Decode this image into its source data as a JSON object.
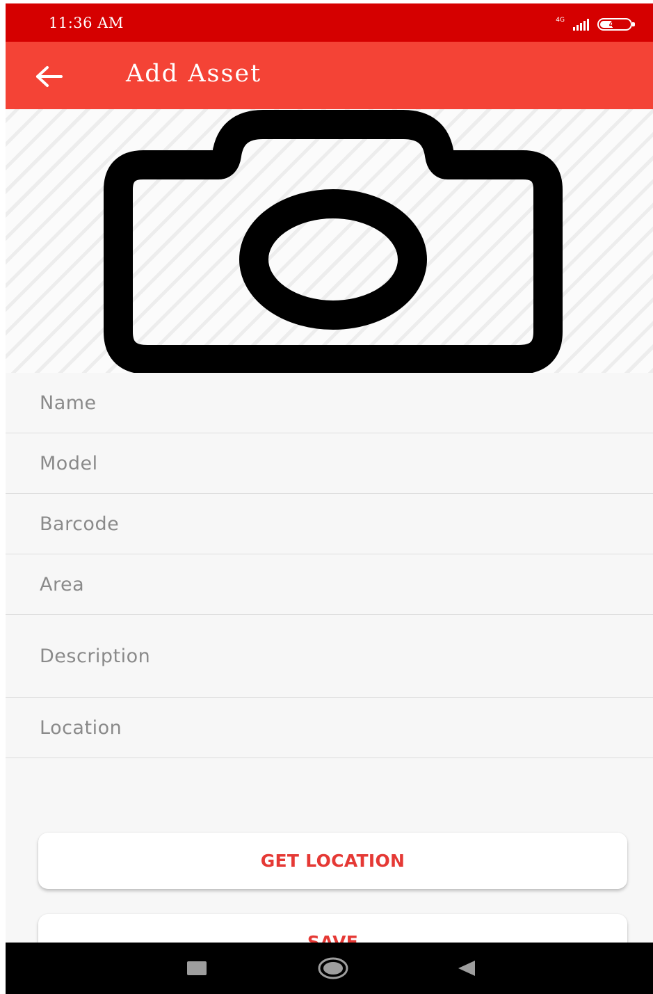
{
  "status_bar": {
    "time": "11:36 AM",
    "network_type": "4G",
    "battery_level": "41"
  },
  "app_bar": {
    "title": "Add Asset",
    "back_icon": "arrow-left-icon"
  },
  "photo": {
    "icon": "camera-icon"
  },
  "form": {
    "name_placeholder": "Name",
    "model_placeholder": "Model",
    "barcode_placeholder": "Barcode",
    "area_placeholder": "Area",
    "description_placeholder": "Description",
    "location_placeholder": "Location"
  },
  "buttons": {
    "get_location_label": "GET LOCATION",
    "save_label": "SAVE"
  },
  "nav_bar": {
    "recents_icon": "square-icon",
    "home_icon": "circle-icon",
    "back_icon": "triangle-back-icon"
  },
  "colors": {
    "status_bar": "#d50000",
    "app_bar": "#f44336",
    "button_text": "#e53935"
  }
}
